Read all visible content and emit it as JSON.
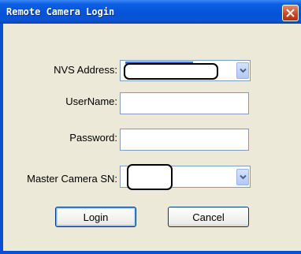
{
  "window": {
    "title": "Remote Camera Login"
  },
  "form": {
    "nvs_address_label": "NVS Address:",
    "username_label": "UserName:",
    "password_label": "Password:",
    "master_camera_label": "Master Camera SN:",
    "username_value": "",
    "password_value": ""
  },
  "buttons": {
    "login": "Login",
    "cancel": "Cancel"
  },
  "icons": {
    "close": "close-icon",
    "dropdown": "chevron-down-icon"
  },
  "colors": {
    "title_bar": "#0a5fe3",
    "window_bg": "#ece9d8",
    "close_button": "#c8431f",
    "field_border": "#7f9db9"
  }
}
